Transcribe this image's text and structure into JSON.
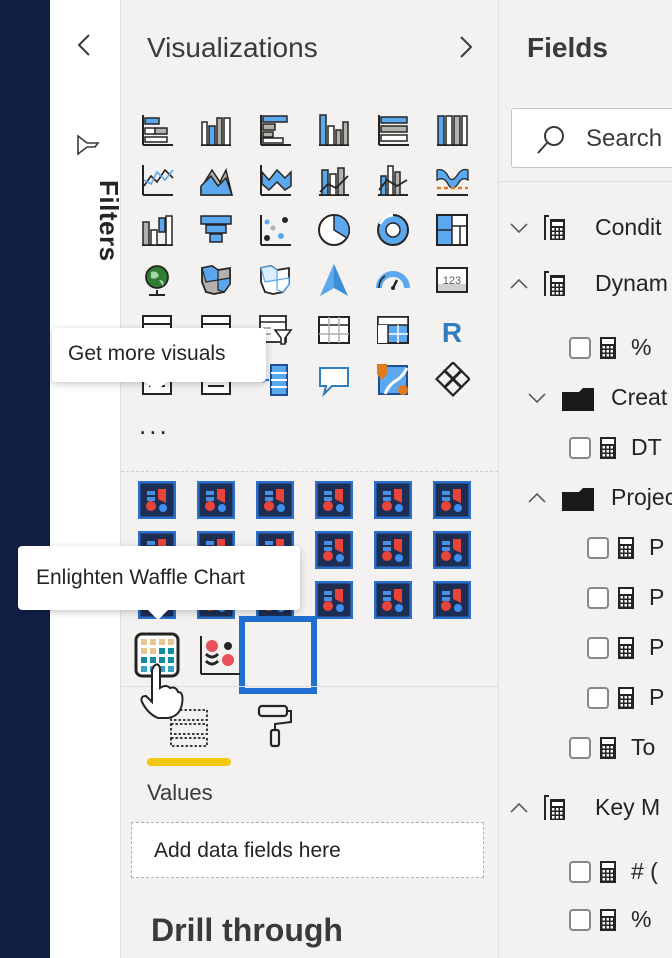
{
  "filters_pane": {
    "label": "Filters",
    "collapse_icon": "chevron-left-icon",
    "filter_icon": "funnel-icon"
  },
  "visualizations_pane": {
    "title": "Visualizations",
    "expand_icon": "chevron-right-icon",
    "builtin_visuals": [
      "stacked-bar-chart",
      "stacked-column-chart",
      "clustered-bar-chart",
      "clustered-column-chart",
      "100-stacked-bar-chart",
      "100-stacked-column-chart",
      "line-chart",
      "area-chart",
      "stacked-area-chart",
      "line-and-stacked-column-chart",
      "line-and-clustered-column-chart",
      "ribbon-chart",
      "waterfall-chart",
      "funnel",
      "scatter-chart",
      "pie-chart",
      "donut-chart",
      "treemap",
      "map",
      "filled-map",
      "shape-map",
      "azure-map",
      "gauge",
      "card",
      "multi-row-card",
      "kpi",
      "slicer",
      "table",
      "matrix",
      "r-script-visual",
      "python-visual",
      "key-influencers",
      "decomposition-tree",
      "q-and-a",
      "smart-narrative",
      "power-apps"
    ],
    "more_label": "...",
    "custom_visual_count": 18,
    "custom_visuals_extra": [
      "enlighten-waffle-chart",
      "dot-plot-chart"
    ],
    "selected_visual": "enlighten-waffle-chart",
    "tooltip_get_more": "Get more visuals",
    "tooltip_waffle": "Enlighten Waffle Chart",
    "tabs": [
      {
        "name": "fields",
        "icon": "fields-well-icon",
        "active": true
      },
      {
        "name": "format",
        "icon": "paint-roller-icon",
        "active": false
      }
    ],
    "values_label": "Values",
    "drop_zone_placeholder": "Add data fields here",
    "drill_through_label": "Drill through",
    "accent_color": "#f2c811",
    "selection_color": "#1f6fd1"
  },
  "fields_pane": {
    "title": "Fields",
    "search_placeholder": "Search",
    "items": [
      {
        "type": "table",
        "label": "Condit",
        "expanded": false
      },
      {
        "type": "table",
        "label": "Dynam",
        "expanded": true
      },
      {
        "type": "measure",
        "label": "%",
        "checked": false
      },
      {
        "type": "folder",
        "label": "Creat",
        "expanded": false
      },
      {
        "type": "measure",
        "label": "DT",
        "checked": false
      },
      {
        "type": "folder",
        "label": "Projec",
        "expanded": true
      },
      {
        "type": "measure",
        "label": "P",
        "checked": false
      },
      {
        "type": "measure",
        "label": "P",
        "checked": false
      },
      {
        "type": "measure",
        "label": "P",
        "checked": false
      },
      {
        "type": "measure",
        "label": "P",
        "checked": false
      },
      {
        "type": "measure",
        "label": "To",
        "checked": false
      },
      {
        "type": "table",
        "label": "Key M",
        "expanded": true
      },
      {
        "type": "measure",
        "label": "# (",
        "checked": false
      },
      {
        "type": "measure",
        "label": "%",
        "checked": false
      }
    ]
  }
}
